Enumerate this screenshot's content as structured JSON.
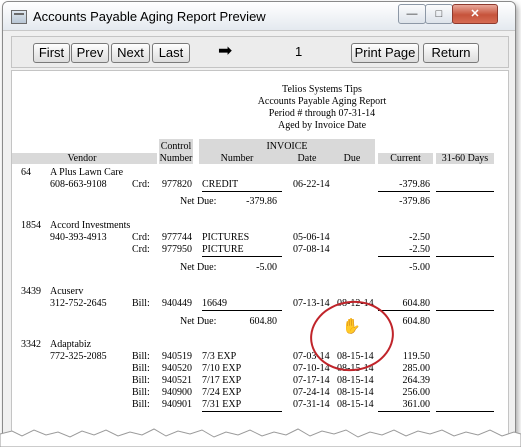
{
  "window": {
    "title": "Accounts Payable Aging Report Preview",
    "min_glyph": "—",
    "max_glyph": "□",
    "close_glyph": "✕"
  },
  "toolbar": {
    "first": "First",
    "prev": "Prev",
    "next": "Next",
    "last": "Last",
    "page": "1",
    "print_page": "Print Page",
    "return": "Return",
    "arrow_glyph": "➡"
  },
  "report": {
    "company": "Telios Systems Tips",
    "title": "Accounts Payable Aging Report",
    "period": "Period # through 07-31-14",
    "subtitle": "Aged by Invoice Date",
    "headers": {
      "control": "Control",
      "control_number": "Number",
      "invoice": "INVOICE",
      "vendor": "Vendor",
      "number": "Number",
      "date": "Date",
      "due": "Due",
      "current": "Current",
      "d3160": "31-60 Days"
    },
    "vendors": [
      {
        "id": "64",
        "name": "A Plus Lawn Care",
        "phone": "608-663-9108",
        "lines": [
          {
            "type": "Crd:",
            "control": "977820",
            "number": "CREDIT",
            "date": "06-22-14",
            "due": "",
            "current": "-379.86"
          }
        ],
        "net_label": "Net Due:",
        "net_amount": "-379.86",
        "net_current": "-379.86"
      },
      {
        "id": "1854",
        "name": "Accord Investments",
        "phone": "940-393-4913",
        "lines": [
          {
            "type": "Crd:",
            "control": "977744",
            "number": "PICTURES",
            "date": "05-06-14",
            "due": "",
            "current": "-2.50"
          },
          {
            "type": "Crd:",
            "control": "977950",
            "number": "PICTURE",
            "date": "07-08-14",
            "due": "",
            "current": "-2.50"
          }
        ],
        "net_label": "Net Due:",
        "net_amount": "-5.00",
        "net_current": "-5.00"
      },
      {
        "id": "3439",
        "name": "Acuserv",
        "phone": "312-752-2645",
        "lines": [
          {
            "type": "Bill:",
            "control": "940449",
            "number": "16649",
            "date": "07-13-14",
            "due": "08-12-14",
            "current": "604.80"
          }
        ],
        "net_label": "Net Due:",
        "net_amount": "604.80",
        "net_current": "604.80"
      },
      {
        "id": "3342",
        "name": "Adaptabiz",
        "phone": "772-325-2085",
        "lines": [
          {
            "type": "Bill:",
            "control": "940519",
            "number": "7/3 EXP",
            "date": "07-03-14",
            "due": "08-15-14",
            "current": "119.50"
          },
          {
            "type": "Bill:",
            "control": "940520",
            "number": "7/10 EXP",
            "date": "07-10-14",
            "due": "08-15-14",
            "current": "285.00"
          },
          {
            "type": "Bill:",
            "control": "940521",
            "number": "7/17 EXP",
            "date": "07-17-14",
            "due": "08-15-14",
            "current": "264.39"
          },
          {
            "type": "Bill:",
            "control": "940900",
            "number": "7/24 EXP",
            "date": "07-24-14",
            "due": "08-15-14",
            "current": "256.00"
          },
          {
            "type": "Bill:",
            "control": "940901",
            "number": "7/31 EXP",
            "date": "07-31-14",
            "due": "08-15-14",
            "current": "361.00"
          }
        ]
      }
    ]
  }
}
